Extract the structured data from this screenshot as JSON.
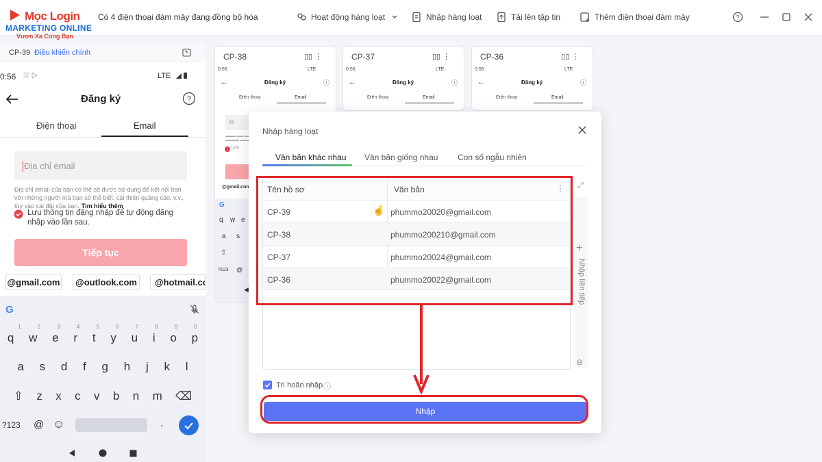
{
  "app": {
    "logo_text": "Mọc Login",
    "logo_line1": "MARKETING ONLINE",
    "logo_line2": "Vươn Xa Cùng Bạn",
    "sync_status": "Có 4 điện thoại đám mây đang đồng bộ hóa",
    "actions": {
      "batch_ops": "Hoạt động hàng loạt",
      "batch_input": "Nhập hàng loạt",
      "upload": "Tải lên tập tin",
      "add_phone": "Thêm điện thoại đám mây"
    }
  },
  "left_panel": {
    "phone_id": "CP-39",
    "control_label": "Điều khiển chính",
    "status_time": "0:56",
    "status_net": "LTE",
    "screen_title": "Đăng ký",
    "tabs": [
      "Điện thoại",
      "Email"
    ],
    "email_placeholder": "Địa chỉ email",
    "disclaimer": "Địa chỉ email của bạn có thể sẽ được sử dụng để kết nối bạn với những người mà bạn có thể biết, cải thiện quảng cáo, v.v., tùy vào cài đặt của bạn.",
    "learn_more": "Tìm hiểu thêm",
    "save_login": "Lưu thông tin đăng nhập để tự động đăng nhập vào lần sau.",
    "continue_label": "Tiếp tục",
    "email_suggestions": [
      "@gmail.com",
      "@outlook.com",
      "@hotmail.com"
    ],
    "keyboard": {
      "row1": [
        "q",
        "w",
        "e",
        "r",
        "t",
        "y",
        "u",
        "i",
        "o",
        "p"
      ],
      "row1_hints": [
        "1",
        "2",
        "3",
        "4",
        "5",
        "6",
        "7",
        "8",
        "9",
        "0"
      ],
      "row2": [
        "a",
        "s",
        "d",
        "f",
        "g",
        "h",
        "j",
        "k",
        "l"
      ],
      "row3": [
        "z",
        "x",
        "c",
        "v",
        "b",
        "n",
        "m"
      ],
      "symbols": "?123",
      "at": "@",
      "period": "."
    }
  },
  "cards": [
    {
      "id": "CP-38",
      "time": "0:56",
      "net": "LTE",
      "title": "Đăng ký",
      "tabs": [
        "Điện thoại",
        "Email"
      ]
    },
    {
      "id": "CP-37",
      "time": "0:56",
      "net": "LTE",
      "title": "Đăng ký",
      "tabs": [
        "Điện thoại",
        "Email"
      ]
    },
    {
      "id": "CP-36",
      "time": "0:56",
      "net": "LTE",
      "title": "Đăng ký",
      "tabs": [
        "Điện thoại",
        "Email"
      ]
    }
  ],
  "card_partial": {
    "placeholder": "Đị",
    "gmail": "@gmail.com",
    "save_text": "Lưu",
    "keys": [
      "q",
      "w",
      "e",
      "a",
      "s",
      "?123",
      "@"
    ]
  },
  "modal": {
    "title": "Nhập hàng loạt",
    "tabs": [
      "Văn bản khác nhau",
      "Văn bản giống nhau",
      "Con số ngẫu nhiên"
    ],
    "active_tab": 0,
    "table": {
      "headers": [
        "Tên hồ sơ",
        "Văn bản"
      ],
      "rows": [
        {
          "profile": "CP-39",
          "text": "phummo20020@gmail.com"
        },
        {
          "profile": "CP-38",
          "text": "phummo200210@gmail.com"
        },
        {
          "profile": "CP-37",
          "text": "phummo20024@gmail.com"
        },
        {
          "profile": "CP-36",
          "text": "phummo20022@gmail.com"
        }
      ]
    },
    "side_label": "Nhập liên tiếp",
    "delay_label": "Trì hoãn nhập",
    "delay_checked": true,
    "submit_label": "Nhập"
  },
  "colors": {
    "accent": "#5b74f6",
    "highlight": "#e0262b",
    "continue_btn": "#f9a5ac",
    "brand_red": "#e23a2e",
    "brand_blue": "#1a6fd8"
  }
}
